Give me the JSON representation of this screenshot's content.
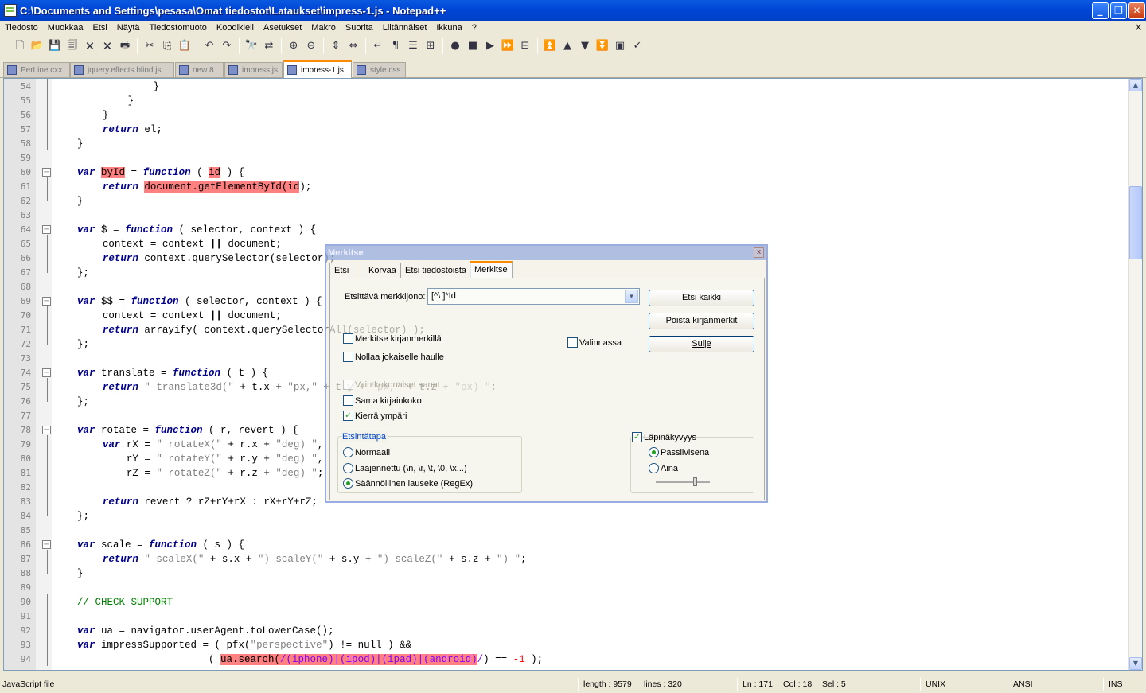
{
  "window": {
    "title": "C:\\Documents and Settings\\pesasa\\Omat tiedostot\\Lataukset\\impress-1.js - Notepad++",
    "minimize": "_",
    "maximize": "❐",
    "close": "✕"
  },
  "menu": [
    "Tiedosto",
    "Muokkaa",
    "Etsi",
    "Näytä",
    "Tiedostomuoto",
    "Koodikieli",
    "Asetukset",
    "Makro",
    "Suorita",
    "Liitännäiset",
    "Ikkuna",
    "?"
  ],
  "menu_close": "X",
  "toolbar": [
    {
      "icon": "new-file-icon",
      "glyph": "🗋"
    },
    {
      "icon": "open-file-icon",
      "glyph": "📂"
    },
    {
      "icon": "save-icon",
      "glyph": "💾"
    },
    {
      "icon": "save-all-icon",
      "glyph": "🗐"
    },
    {
      "icon": "close-file-icon",
      "glyph": "🗙"
    },
    {
      "icon": "close-all-icon",
      "glyph": "🗙"
    },
    {
      "icon": "print-icon",
      "glyph": "🖶"
    },
    {
      "sep": true
    },
    {
      "icon": "cut-icon",
      "glyph": "✂"
    },
    {
      "icon": "copy-icon",
      "glyph": "⎘"
    },
    {
      "icon": "paste-icon",
      "glyph": "📋"
    },
    {
      "sep": true
    },
    {
      "icon": "undo-icon",
      "glyph": "↶"
    },
    {
      "icon": "redo-icon",
      "glyph": "↷"
    },
    {
      "sep": true
    },
    {
      "icon": "find-icon",
      "glyph": "🔭"
    },
    {
      "icon": "replace-icon",
      "glyph": "⇄"
    },
    {
      "sep": true
    },
    {
      "icon": "zoom-in-icon",
      "glyph": "⊕"
    },
    {
      "icon": "zoom-out-icon",
      "glyph": "⊖"
    },
    {
      "sep": true
    },
    {
      "icon": "sync-vertical-icon",
      "glyph": "⇕"
    },
    {
      "icon": "sync-horizontal-icon",
      "glyph": "⇔"
    },
    {
      "sep": true
    },
    {
      "icon": "word-wrap-icon",
      "glyph": "↵"
    },
    {
      "icon": "show-all-chars-icon",
      "glyph": "¶"
    },
    {
      "icon": "indent-guide-icon",
      "glyph": "☰"
    },
    {
      "icon": "user-lang-icon",
      "glyph": "⊞"
    },
    {
      "sep": true
    },
    {
      "icon": "record-macro-icon",
      "glyph": "●"
    },
    {
      "icon": "stop-record-icon",
      "glyph": "■"
    },
    {
      "icon": "play-macro-icon",
      "glyph": "▶"
    },
    {
      "icon": "play-multiple-icon",
      "glyph": "⏩"
    },
    {
      "icon": "save-macro-icon",
      "glyph": "⊟"
    },
    {
      "sep": true
    },
    {
      "icon": "bookmark-first-icon",
      "glyph": "⏫"
    },
    {
      "icon": "bookmark-prev-icon",
      "glyph": "▲"
    },
    {
      "icon": "bookmark-next-icon",
      "glyph": "▼"
    },
    {
      "icon": "bookmark-last-icon",
      "glyph": "⏬"
    },
    {
      "icon": "plugin-icon",
      "glyph": "▣"
    },
    {
      "icon": "spellcheck-icon",
      "glyph": "✓"
    }
  ],
  "tabs": [
    {
      "label": "PerLine.cxx",
      "active": false
    },
    {
      "label": "jquery.effects.blind.js",
      "active": false
    },
    {
      "label": "new  8",
      "active": false
    },
    {
      "label": "impress.js",
      "active": false
    },
    {
      "label": "impress-1.js",
      "active": true
    },
    {
      "label": "style.css",
      "active": false
    }
  ],
  "editor": {
    "lines": [
      {
        "n": "54",
        "indent": 12,
        "segs": [
          [
            "",
            "}"
          ]
        ]
      },
      {
        "n": "55",
        "indent": 8,
        "segs": [
          [
            "",
            "}"
          ]
        ]
      },
      {
        "n": "56",
        "indent": 4,
        "segs": [
          [
            "",
            "}"
          ]
        ]
      },
      {
        "n": "57",
        "indent": 4,
        "segs": [
          [
            "kw",
            "return"
          ],
          [
            "",
            " el;"
          ]
        ]
      },
      {
        "n": "58",
        "indent": 0,
        "segs": [
          [
            "",
            "}"
          ]
        ]
      },
      {
        "n": "59",
        "indent": 0,
        "segs": []
      },
      {
        "n": "60",
        "indent": 0,
        "fold": "open",
        "segs": [
          [
            "kw",
            "var"
          ],
          [
            "",
            " "
          ],
          [
            "hl",
            "byId"
          ],
          [
            "",
            " = "
          ],
          [
            "kw",
            "function"
          ],
          [
            "",
            " ( "
          ],
          [
            "hl",
            "id"
          ],
          [
            "",
            " ) {"
          ]
        ]
      },
      {
        "n": "61",
        "indent": 4,
        "segs": [
          [
            "kw",
            "return"
          ],
          [
            "",
            " "
          ],
          [
            "hl",
            "document.getElementById(id"
          ],
          [
            "",
            ");"
          ]
        ]
      },
      {
        "n": "62",
        "indent": 0,
        "segs": [
          [
            "",
            "}"
          ]
        ]
      },
      {
        "n": "63",
        "indent": 0,
        "segs": []
      },
      {
        "n": "64",
        "indent": 0,
        "fold": "open",
        "segs": [
          [
            "kw",
            "var"
          ],
          [
            "",
            " $ = "
          ],
          [
            "kw",
            "function"
          ],
          [
            "",
            " ( selector, context ) {"
          ]
        ]
      },
      {
        "n": "65",
        "indent": 4,
        "segs": [
          [
            "",
            "context = context "
          ],
          [
            "op",
            "||"
          ],
          [
            "",
            " document;"
          ]
        ]
      },
      {
        "n": "66",
        "indent": 4,
        "segs": [
          [
            "kw",
            "return"
          ],
          [
            "",
            " context.querySelector(selector);"
          ]
        ]
      },
      {
        "n": "67",
        "indent": 0,
        "segs": [
          [
            "",
            "};"
          ]
        ]
      },
      {
        "n": "68",
        "indent": 0,
        "segs": []
      },
      {
        "n": "69",
        "indent": 0,
        "fold": "open",
        "segs": [
          [
            "kw",
            "var"
          ],
          [
            "",
            " $$ = "
          ],
          [
            "kw",
            "function"
          ],
          [
            "",
            " ( selector, context ) {"
          ]
        ]
      },
      {
        "n": "70",
        "indent": 4,
        "segs": [
          [
            "",
            "context = context "
          ],
          [
            "op",
            "||"
          ],
          [
            "",
            " document;"
          ]
        ]
      },
      {
        "n": "71",
        "indent": 4,
        "segs": [
          [
            "kw",
            "return"
          ],
          [
            "",
            " arrayify( context.querySelectorAll(selector) );"
          ]
        ]
      },
      {
        "n": "72",
        "indent": 0,
        "segs": [
          [
            "",
            "};"
          ]
        ]
      },
      {
        "n": "73",
        "indent": 0,
        "segs": []
      },
      {
        "n": "74",
        "indent": 0,
        "fold": "open",
        "segs": [
          [
            "kw",
            "var"
          ],
          [
            "",
            " translate = "
          ],
          [
            "kw",
            "function"
          ],
          [
            "",
            " ( t ) {"
          ]
        ]
      },
      {
        "n": "75",
        "indent": 4,
        "segs": [
          [
            "kw",
            "return"
          ],
          [
            "",
            " "
          ],
          [
            "str",
            "\" translate3d(\""
          ],
          [
            "",
            " + t.x + "
          ],
          [
            "str",
            "\"px,\""
          ],
          [
            "",
            " + t.y + "
          ],
          [
            "str",
            "\"px,\""
          ],
          [
            "",
            " + t.z + "
          ],
          [
            "str",
            "\"px) \""
          ],
          [
            "",
            ";"
          ]
        ]
      },
      {
        "n": "76",
        "indent": 0,
        "segs": [
          [
            "",
            "};"
          ]
        ]
      },
      {
        "n": "77",
        "indent": 0,
        "segs": []
      },
      {
        "n": "78",
        "indent": 0,
        "fold": "open",
        "segs": [
          [
            "kw",
            "var"
          ],
          [
            "",
            " rotate = "
          ],
          [
            "kw",
            "function"
          ],
          [
            "",
            " ( r, revert ) {"
          ]
        ]
      },
      {
        "n": "79",
        "indent": 4,
        "segs": [
          [
            "kw",
            "var"
          ],
          [
            "",
            " rX = "
          ],
          [
            "str",
            "\" rotateX(\""
          ],
          [
            "",
            " + r.x + "
          ],
          [
            "str",
            "\"deg) \""
          ],
          [
            "",
            ","
          ]
        ]
      },
      {
        "n": "80",
        "indent": 4,
        "segs": [
          [
            "",
            "    rY = "
          ],
          [
            "str",
            "\" rotateY(\""
          ],
          [
            "",
            " + r.y + "
          ],
          [
            "str",
            "\"deg) \""
          ],
          [
            "",
            ","
          ]
        ]
      },
      {
        "n": "81",
        "indent": 4,
        "segs": [
          [
            "",
            "    rZ = "
          ],
          [
            "str",
            "\" rotateZ(\""
          ],
          [
            "",
            " + r.z + "
          ],
          [
            "str",
            "\"deg) \""
          ],
          [
            "",
            ";"
          ]
        ]
      },
      {
        "n": "82",
        "indent": 0,
        "segs": []
      },
      {
        "n": "83",
        "indent": 4,
        "segs": [
          [
            "kw",
            "return"
          ],
          [
            "",
            " revert ? rZ+rY+rX : rX+rY+rZ;"
          ]
        ]
      },
      {
        "n": "84",
        "indent": 0,
        "segs": [
          [
            "",
            "};"
          ]
        ]
      },
      {
        "n": "85",
        "indent": 0,
        "segs": []
      },
      {
        "n": "86",
        "indent": 0,
        "fold": "open",
        "segs": [
          [
            "kw",
            "var"
          ],
          [
            "",
            " scale = "
          ],
          [
            "kw",
            "function"
          ],
          [
            "",
            " ( s ) {"
          ]
        ]
      },
      {
        "n": "87",
        "indent": 4,
        "segs": [
          [
            "kw",
            "return"
          ],
          [
            "",
            " "
          ],
          [
            "str",
            "\" scaleX(\""
          ],
          [
            "",
            " + s.x + "
          ],
          [
            "str",
            "\") scaleY(\""
          ],
          [
            "",
            " + s.y + "
          ],
          [
            "str",
            "\") scaleZ(\""
          ],
          [
            "",
            " + s.z + "
          ],
          [
            "str",
            "\") \""
          ],
          [
            "",
            ";"
          ]
        ]
      },
      {
        "n": "88",
        "indent": 0,
        "segs": [
          [
            "",
            "}"
          ]
        ]
      },
      {
        "n": "89",
        "indent": 0,
        "segs": []
      },
      {
        "n": "90",
        "indent": 0,
        "segs": [
          [
            "cm",
            "// CHECK SUPPORT"
          ]
        ]
      },
      {
        "n": "91",
        "indent": 0,
        "segs": []
      },
      {
        "n": "92",
        "indent": 0,
        "segs": [
          [
            "kw",
            "var"
          ],
          [
            "",
            " ua = navigator.userAgent.toLowerCase();"
          ]
        ]
      },
      {
        "n": "93",
        "indent": 0,
        "segs": [
          [
            "kw",
            "var"
          ],
          [
            "",
            " impressSupported = ( pfx("
          ],
          [
            "str",
            "\"perspective\""
          ],
          [
            "",
            ") != null ) &&"
          ]
        ]
      },
      {
        "n": "94",
        "indent": 0,
        "segs": [
          [
            "",
            "                      ( "
          ],
          [
            "hl",
            "ua.search("
          ],
          [
            "hlre",
            "/(iphone)|(ipod)|(ipad)|(android)"
          ],
          [
            "re",
            "/"
          ],
          [
            "",
            ") == "
          ],
          [
            "num",
            "-1"
          ],
          [
            "",
            " );"
          ]
        ]
      }
    ]
  },
  "find_dialog": {
    "title": "Merkitse",
    "close": "x",
    "tabs": [
      "Etsi",
      "Korvaa",
      "Etsi tiedostoista",
      "Merkitse"
    ],
    "active_tab": "Merkitse",
    "search_label": "Etsittävä merkkijono:",
    "search_value": "[^\\ ]*Id",
    "buttons": {
      "find_all": "Etsi kaikki",
      "clear_marks": "Poista kirjanmerkit",
      "close": "Sulje"
    },
    "options": {
      "bookmark_line": "Merkitse kirjanmerkillä",
      "purge": "Nollaa jokaiselle haulle",
      "in_selection": "Valinnassa",
      "whole_word": "Vain kokonaiset sanat",
      "match_case": "Sama kirjainkoko",
      "wrap": "Kierrä ympäri"
    },
    "search_mode": {
      "title": "Etsintätapa",
      "normal": "Normaali",
      "extended": "Laajennettu (\\n, \\r, \\t, \\0, \\x...)",
      "regex": "Säännöllinen lauseke (RegEx)"
    },
    "transparency": {
      "label": "Läpinäkyvyys",
      "on_losing_focus": "Passiivisena",
      "always": "Aina",
      "level": 0.75
    }
  },
  "status": {
    "filetype": "JavaScript file",
    "length": "length : 9579",
    "lines": "lines : 320",
    "ln": "Ln : 171",
    "col": "Col : 18",
    "sel": "Sel : 5",
    "eol": "UNIX",
    "encoding": "ANSI",
    "mode": "INS"
  }
}
